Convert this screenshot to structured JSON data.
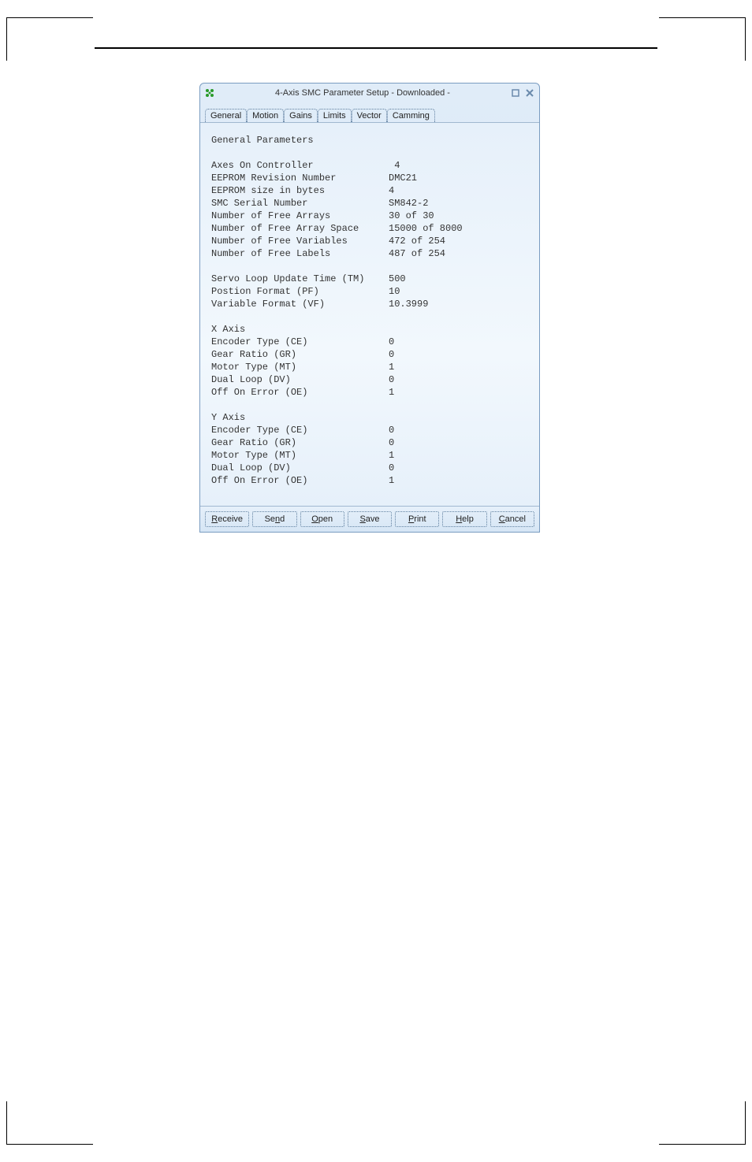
{
  "window": {
    "title": "4-Axis SMC Parameter Setup - Downloaded -"
  },
  "tabs": [
    {
      "label": "General"
    },
    {
      "label": "Motion"
    },
    {
      "label": "Gains"
    },
    {
      "label": "Limits"
    },
    {
      "label": "Vector"
    },
    {
      "label": "Camming"
    }
  ],
  "header": "General Parameters",
  "params": [
    {
      "label": "Axes On Controller",
      "value": " 4"
    },
    {
      "label": "EEPROM Revision Number",
      "value": "DMC21"
    },
    {
      "label": "EEPROM size in bytes",
      "value": "4"
    },
    {
      "label": "SMC Serial Number",
      "value": "SM842-2"
    },
    {
      "label": "Number of Free Arrays",
      "value": "30 of 30"
    },
    {
      "label": "Number of Free Array Space",
      "value": "15000 of 8000"
    },
    {
      "label": "Number of Free Variables",
      "value": "472 of 254"
    },
    {
      "label": "Number of Free Labels",
      "value": "487 of 254"
    }
  ],
  "servo": [
    {
      "label": "Servo Loop Update Time (TM)",
      "value": "500"
    },
    {
      "label": "Postion Format (PF)",
      "value": "10"
    },
    {
      "label": "Variable Format (VF)",
      "value": "10.3999"
    }
  ],
  "xaxis_title": "X Axis",
  "xaxis": [
    {
      "label": "Encoder Type (CE)",
      "value": "0"
    },
    {
      "label": "Gear Ratio (GR)",
      "value": "0"
    },
    {
      "label": "Motor Type (MT)",
      "value": "1"
    },
    {
      "label": "Dual Loop (DV)",
      "value": "0"
    },
    {
      "label": "Off On Error (OE)",
      "value": "1"
    }
  ],
  "yaxis_title": "Y Axis",
  "yaxis": [
    {
      "label": "Encoder Type (CE)",
      "value": "0"
    },
    {
      "label": "Gear Ratio (GR)",
      "value": "0"
    },
    {
      "label": "Motor Type (MT)",
      "value": "1"
    },
    {
      "label": "Dual Loop (DV)",
      "value": "0"
    },
    {
      "label": "Off On Error (OE)",
      "value": "1"
    }
  ],
  "buttons": {
    "receive": {
      "pre": "",
      "u": "R",
      "post": "eceive"
    },
    "send": {
      "pre": "Se",
      "u": "n",
      "post": "d"
    },
    "open": {
      "pre": "",
      "u": "O",
      "post": "pen"
    },
    "save": {
      "pre": "",
      "u": "S",
      "post": "ave"
    },
    "print": {
      "pre": "",
      "u": "P",
      "post": "rint"
    },
    "help": {
      "pre": "",
      "u": "H",
      "post": "elp"
    },
    "cancel": {
      "pre": "",
      "u": "C",
      "post": "ancel"
    }
  }
}
